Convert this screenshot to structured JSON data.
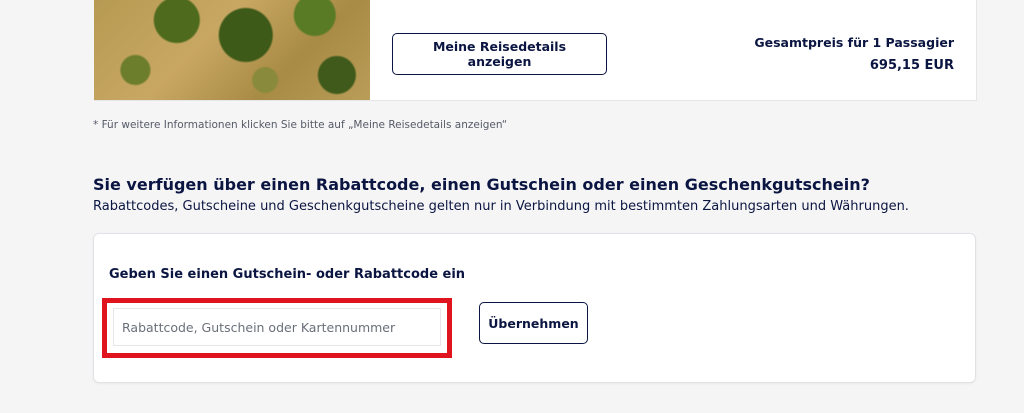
{
  "trip": {
    "details_button": "Meine Reisedetails anzeigen",
    "price_label": "Gesamtpreis für 1 Passagier",
    "price_value": "695,15 EUR"
  },
  "footnote": "* Für weitere Informationen klicken Sie bitte auf „Meine Reisedetails anzeigen“",
  "discount": {
    "title": "Sie verfügen über einen Rabattcode, einen Gutschein oder einen Geschenkgutschein?",
    "subtitle": "Rabattcodes, Gutscheine und Geschenkgutscheine gelten nur in Verbindung mit bestimmten Zahlungsarten und Währungen.",
    "card_heading": "Geben Sie einen Gutschein- oder Rabattcode ein",
    "input_placeholder": "Rabattcode, Gutschein oder Kartennummer",
    "input_value": "",
    "apply_button": "Übernehmen"
  },
  "colors": {
    "text_primary": "#0b1541",
    "highlight_border": "#e0141e",
    "page_background": "#f5f5f6"
  }
}
